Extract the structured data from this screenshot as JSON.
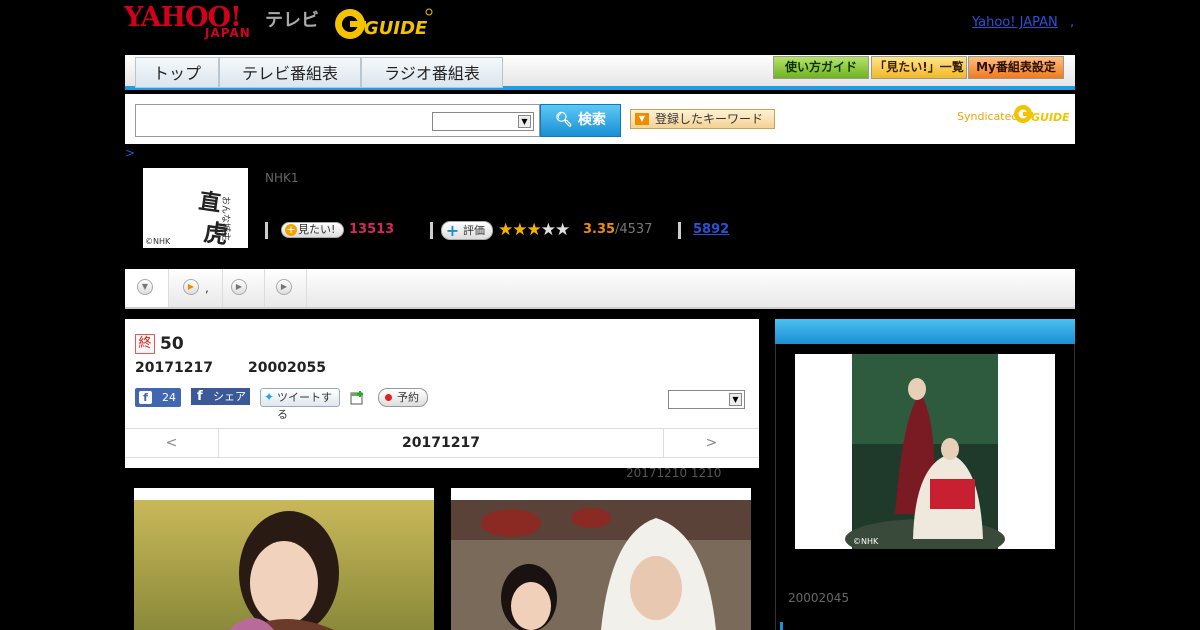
{
  "header": {
    "logo_yahoo": "YAHOO!",
    "logo_japan": "JAPAN",
    "logo_tv": "テレビ",
    "logo_gguide": "G GUIDE",
    "yahoo_japan_link": "Yahoo! JAPAN",
    "dot_link": ","
  },
  "nav": {
    "tabs": [
      "トップ",
      "テレビ番組表",
      "ラジオ番組表"
    ],
    "guide_label": "使い方ガイド",
    "mitai_list_label": "「見たい!」一覧",
    "my_program_label": "My番組表設定"
  },
  "search": {
    "placeholder": "",
    "select_value": "",
    "button_label": "検索",
    "keyword_button_label": "登録したキーワード",
    "syndicated_label": "Syndicated",
    "syndicated_logo": "G GUIDE"
  },
  "breadcrumb": ">",
  "program": {
    "thumb_title": "おんな城主 直虎",
    "copyright": "©NHK",
    "channel": "NHK1",
    "mitai_label": "見たい!",
    "mitai_count": "13513",
    "hyoka_label": "評価",
    "rating": "3.35",
    "rating_total": "/4537",
    "link_count": "5892",
    "stars_on": 3,
    "stars_total": 5
  },
  "tabstrip": {
    "tab2_text": ","
  },
  "episode": {
    "end_badge": "終",
    "number": "50",
    "date": "20171217",
    "id": "20002055",
    "fb_like_count": "24",
    "fb_share_label": "シェア",
    "tweet_label": "ツイートする",
    "reserve_label": "予約",
    "nav_prev": "<",
    "nav_current": "20171217",
    "nav_next": ">",
    "prev_note": "20171210  1210"
  },
  "sidebar": {
    "copyright": "©NHK",
    "id": "20002045"
  },
  "colors": {
    "accent_blue": "#1ea0e0",
    "mitai_pink": "#d6285b",
    "rating_orange": "#f08c00",
    "link_blue": "#2b50d5"
  }
}
